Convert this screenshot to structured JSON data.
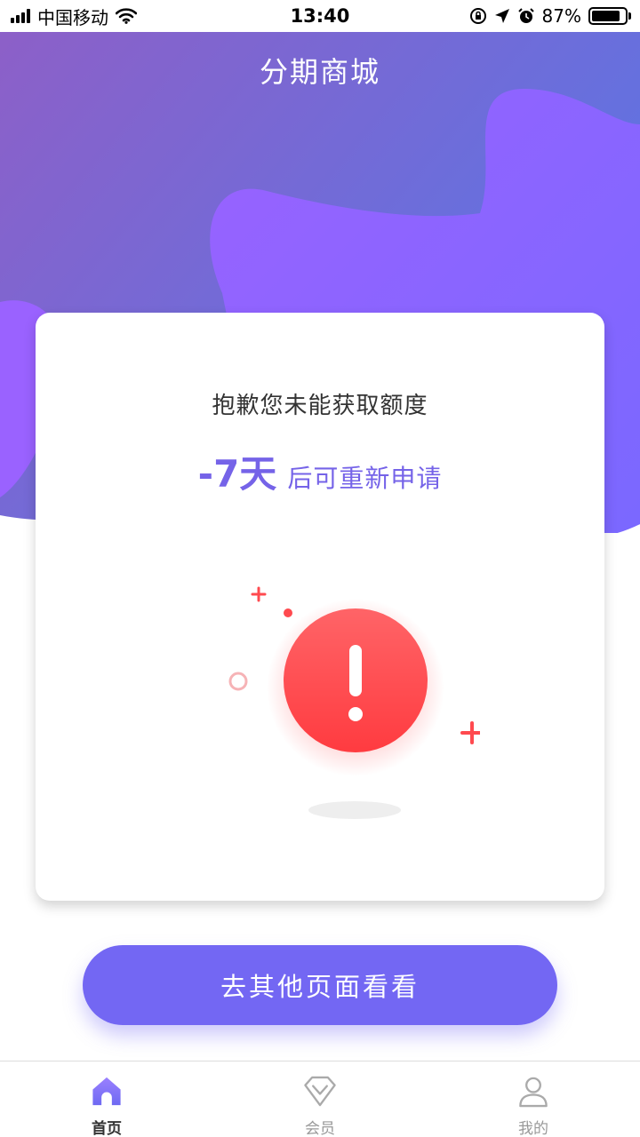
{
  "status_bar": {
    "carrier": "中国移动",
    "time": "13:40",
    "battery_percent": "87%",
    "battery_level": 0.87
  },
  "header": {
    "title": "分期商城"
  },
  "card": {
    "message": "抱歉您未能获取额度",
    "countdown_value": "-7天",
    "countdown_text": "后可重新申请"
  },
  "action_button": {
    "label": "去其他页面看看"
  },
  "tab_bar": {
    "tabs": [
      {
        "label": "首页",
        "icon": "home-icon",
        "active": true
      },
      {
        "label": "会员",
        "icon": "diamond-icon",
        "active": false
      },
      {
        "label": "我的",
        "icon": "user-icon",
        "active": false
      }
    ]
  },
  "colors": {
    "accent": "#7367f3",
    "alert": "#ff4a4f",
    "header_gradient_start": "#8e5fc7",
    "header_gradient_end": "#5c73e3"
  }
}
